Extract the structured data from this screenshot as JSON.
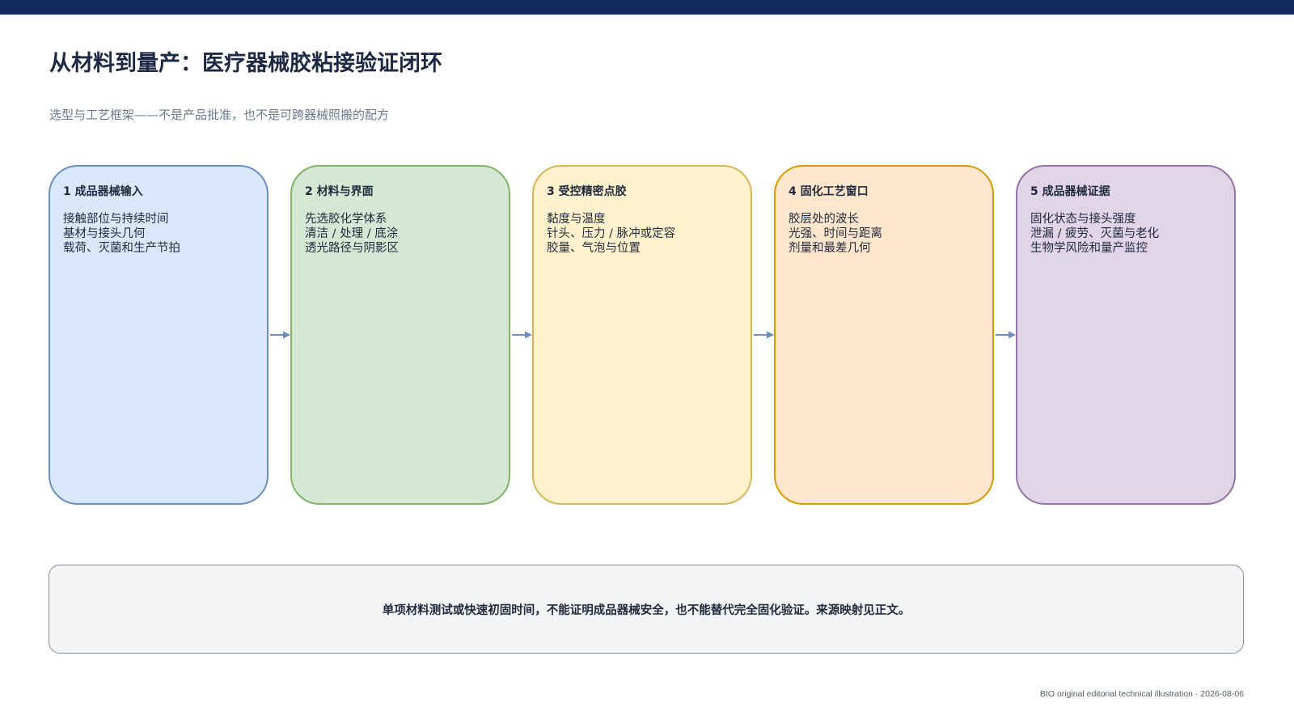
{
  "title": "从材料到量产：医疗器械胶粘接验证闭环",
  "subtitle": "选型与工艺框架——不是产品批准，也不是可跨器械照搬的配方",
  "stages": [
    {
      "title": "1 成品器械输入",
      "lines": [
        "接触部位与持续时间",
        "基材与接头几何",
        "载荷、灭菌和生产节拍"
      ],
      "fill": "#dae8fc",
      "border": "#6c8ebf"
    },
    {
      "title": "2 材料与界面",
      "lines": [
        "先选胶化学体系",
        "清洁 / 处理 / 底涂",
        "透光路径与阴影区"
      ],
      "fill": "#d5e8d4",
      "border": "#82b366"
    },
    {
      "title": "3 受控精密点胶",
      "lines": [
        "黏度与温度",
        "针头、压力 / 脉冲或定容",
        "胶量、气泡与位置"
      ],
      "fill": "#fff2cc",
      "border": "#d6b656"
    },
    {
      "title": "4 固化工艺窗口",
      "lines": [
        "胶层处的波长",
        "光强、时间与距离",
        "剂量和最差几何"
      ],
      "fill": "#ffe6cc",
      "border": "#d79b00"
    },
    {
      "title": "5 成品器械证据",
      "lines": [
        "固化状态与接头强度",
        "泄漏 / 疲劳、灭菌与老化",
        "生物学风险和量产监控"
      ],
      "fill": "#e1d5e7",
      "border": "#9673a6"
    }
  ],
  "arrow_color": "#6c8ebf",
  "note": "单项材料测试或快速初固时间，不能证明成品器械安全，也不能替代完全固化验证。来源映射见正文。",
  "footer": "BIO original editorial technical illustration · 2026-08-06"
}
